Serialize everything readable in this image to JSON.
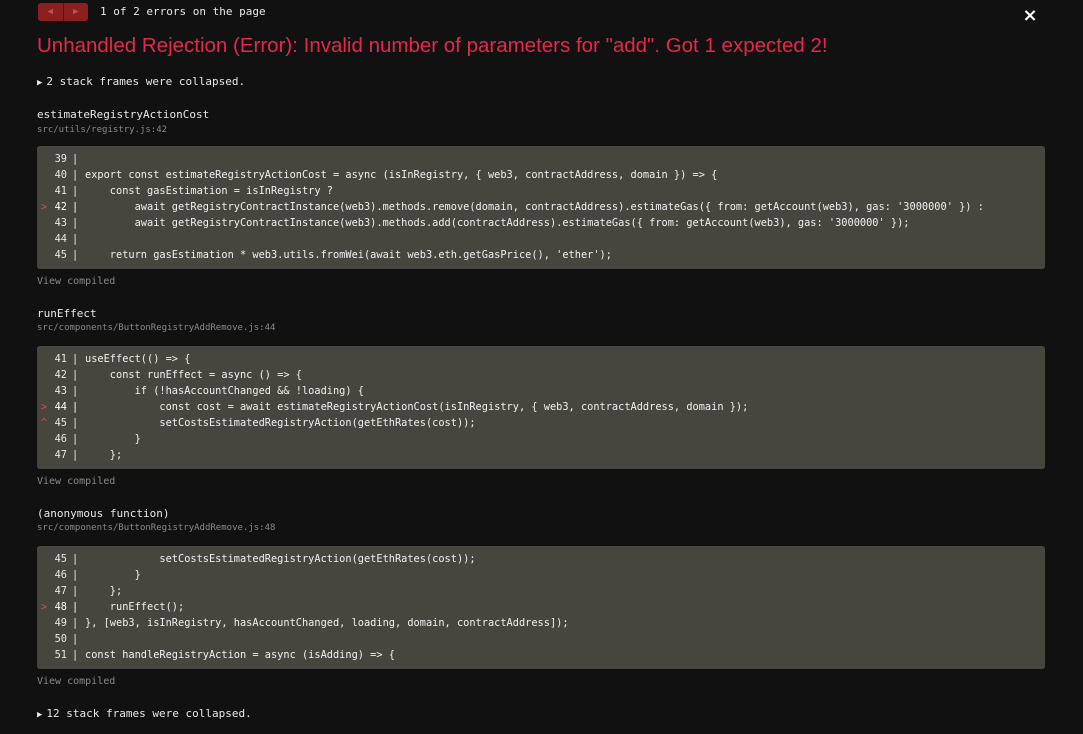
{
  "header": {
    "prev_label": "◀",
    "next_label": "▶",
    "error_count": "1 of 2 errors on the page",
    "close_label": "×"
  },
  "error": {
    "title": "Unhandled Rejection (Error): Invalid number of parameters for \"add\". Got 1 expected 2!"
  },
  "collapsed_top": {
    "label": "2 stack frames were collapsed."
  },
  "frames": [
    {
      "function": "estimateRegistryActionCost",
      "file": "src/utils/registry.js:42",
      "view_compiled": "View compiled",
      "lines": [
        {
          "num": "39",
          "marker": "",
          "code": ""
        },
        {
          "num": "40",
          "marker": "",
          "code": "export const estimateRegistryActionCost = async (isInRegistry, { web3, contractAddress, domain }) => {"
        },
        {
          "num": "41",
          "marker": "",
          "code": "    const gasEstimation = isInRegistry ?"
        },
        {
          "num": "42",
          "marker": ">",
          "code": "        await getRegistryContractInstance(web3).methods.remove(domain, contractAddress).estimateGas({ from: getAccount(web3), gas: '3000000' }) :"
        },
        {
          "num": "43",
          "marker": "",
          "code": "        await getRegistryContractInstance(web3).methods.add(contractAddress).estimateGas({ from: getAccount(web3), gas: '3000000' });"
        },
        {
          "num": "44",
          "marker": "",
          "code": ""
        },
        {
          "num": "45",
          "marker": "",
          "code": "    return gasEstimation * web3.utils.fromWei(await web3.eth.getGasPrice(), 'ether');"
        }
      ]
    },
    {
      "function": "runEffect",
      "file": "src/components/ButtonRegistryAddRemove.js:44",
      "view_compiled": "View compiled",
      "lines": [
        {
          "num": "41",
          "marker": "",
          "code": "useEffect(() => {"
        },
        {
          "num": "42",
          "marker": "",
          "code": "    const runEffect = async () => {"
        },
        {
          "num": "43",
          "marker": "",
          "code": "        if (!hasAccountChanged && !loading) {"
        },
        {
          "num": "44",
          "marker": ">",
          "code": "            const cost = await estimateRegistryActionCost(isInRegistry, { web3, contractAddress, domain });"
        },
        {
          "num": "45",
          "marker": "^",
          "code": "            setCostsEstimatedRegistryAction(getEthRates(cost));"
        },
        {
          "num": "46",
          "marker": "",
          "code": "        }"
        },
        {
          "num": "47",
          "marker": "",
          "code": "    };"
        }
      ]
    },
    {
      "function": "(anonymous function)",
      "file": "src/components/ButtonRegistryAddRemove.js:48",
      "view_compiled": "View compiled",
      "lines": [
        {
          "num": "45",
          "marker": "",
          "code": "            setCostsEstimatedRegistryAction(getEthRates(cost));"
        },
        {
          "num": "46",
          "marker": "",
          "code": "        }"
        },
        {
          "num": "47",
          "marker": "",
          "code": "    };"
        },
        {
          "num": "48",
          "marker": ">",
          "code": "    runEffect();"
        },
        {
          "num": "49",
          "marker": "",
          "code": "}, [web3, isInRegistry, hasAccountChanged, loading, domain, contractAddress]);"
        },
        {
          "num": "50",
          "marker": "",
          "code": ""
        },
        {
          "num": "51",
          "marker": "",
          "code": "const handleRegistryAction = async (isAdding) => {"
        }
      ]
    }
  ],
  "collapsed_bottom": {
    "label": "12 stack frames were collapsed."
  },
  "colors": {
    "background": "#111111",
    "error_red": "#e8264a",
    "code_bg": "#46463e",
    "muted": "#8a8a8a"
  }
}
